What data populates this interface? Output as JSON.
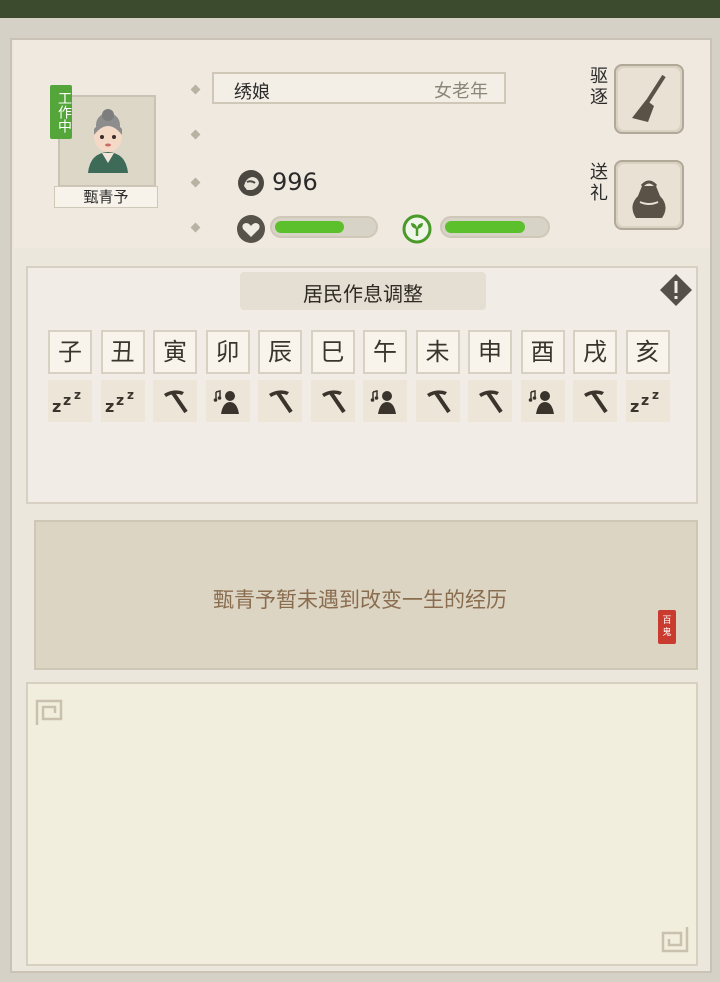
{
  "resident": {
    "name": "甄青予",
    "status": "工作中",
    "job": "绣娘",
    "age_group": "女老年",
    "coins": "996",
    "health_level": 0.7,
    "mood_level": 0.8
  },
  "actions": {
    "expel_label": "驱逐",
    "gift_label": "送礼"
  },
  "schedule": {
    "title": "居民作息调整",
    "hours": [
      "子",
      "丑",
      "寅",
      "卯",
      "辰",
      "巳",
      "午",
      "未",
      "申",
      "酉",
      "戌",
      "亥"
    ],
    "activities": [
      "sleep",
      "sleep",
      "work",
      "rest",
      "work",
      "work",
      "rest",
      "work",
      "work",
      "rest",
      "work",
      "sleep"
    ]
  },
  "history": {
    "text": "甄青予暂未遇到改变一生的经历",
    "seal_text": "百鬼"
  },
  "colors": {
    "status_green": "#55a63a",
    "bar_green": "#5cbf2c",
    "history_text": "#8a6d4f",
    "seal_red": "#c93b2f"
  }
}
